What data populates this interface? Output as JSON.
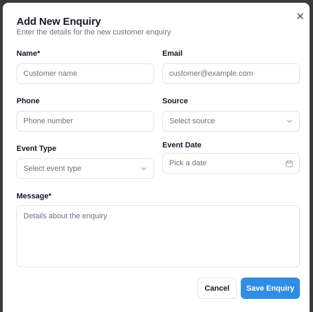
{
  "dialog": {
    "title": "Add New Enquiry",
    "subtitle": "Enter the details for the new customer enquiry",
    "close_icon": "close-icon"
  },
  "form": {
    "name": {
      "label": "Name*",
      "placeholder": "Customer name"
    },
    "email": {
      "label": "Email",
      "placeholder": "customer@example.com"
    },
    "phone": {
      "label": "Phone",
      "placeholder": "Phone number"
    },
    "source": {
      "label": "Source",
      "placeholder": "Select source",
      "icon": "chevron-down-icon"
    },
    "event_type": {
      "label": "Event Type",
      "placeholder": "Select event type",
      "icon": "chevron-down-icon"
    },
    "event_date": {
      "label": "Event Date",
      "placeholder": "Pick a date",
      "icon": "calendar-icon"
    },
    "message": {
      "label": "Message*",
      "placeholder": "Details about the enquiry"
    }
  },
  "actions": {
    "cancel_label": "Cancel",
    "save_label": "Save Enquiry"
  },
  "colors": {
    "primary": "#2f8de4",
    "overlay": "#3a3a3a",
    "border": "#e2e4e9",
    "muted_text": "#6b7280"
  }
}
